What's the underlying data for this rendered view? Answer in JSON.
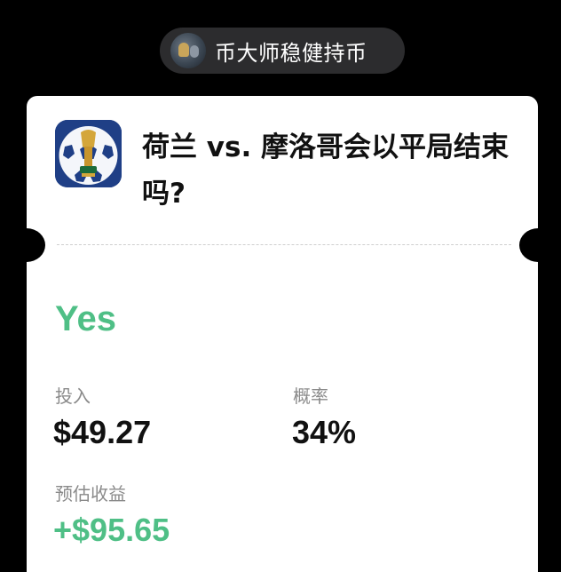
{
  "user": {
    "name": "币大师稳健持币",
    "avatar_icon": "user-avatar"
  },
  "market": {
    "icon": "soccer-trophy-icon",
    "title": "荷兰 vs. 摩洛哥会以平局结束吗?"
  },
  "position": {
    "outcome": "Yes",
    "stake_label": "投入",
    "stake_value": "$49.27",
    "probability_label": "概率",
    "probability_value": "34%",
    "payout_label": "预估收益",
    "payout_value": "+$95.65"
  },
  "colors": {
    "background": "#000000",
    "card": "#ffffff",
    "pill": "#2c2c2e",
    "accent_green": "#4fbf86",
    "muted_text": "#8a8a8a",
    "icon_bg": "#1f3f86"
  }
}
